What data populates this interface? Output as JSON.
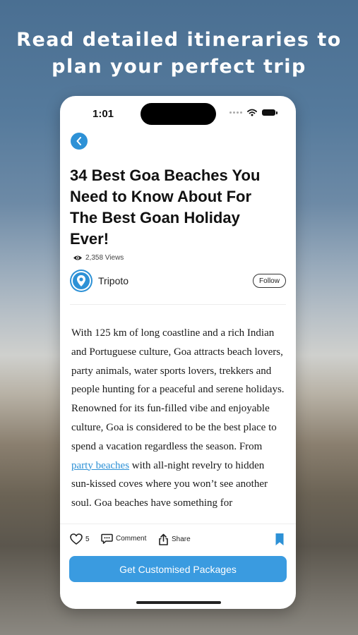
{
  "promo": {
    "line1": "Read detailed itineraries to",
    "line2": "plan your perfect trip"
  },
  "status_bar": {
    "time": "1:01",
    "icons": [
      "signal-dots-icon",
      "wifi-icon",
      "battery-icon"
    ]
  },
  "article": {
    "back_icon": "chevron-left-icon",
    "title": "34 Best Goa Beaches You Need to Know About For The Best Goan Holiday Ever!",
    "views": "2,358 Views",
    "author": {
      "name": "Tripoto",
      "follow_label": "Follow"
    },
    "body": {
      "part1": "With 125 km of long coastline and a rich Indian and Portuguese culture, Goa attracts beach lovers, party animals, water sports lovers, trekkers and people hunting for a peaceful and serene holidays. Renowned for its fun-filled vibe and enjoyable culture, Goa is considered to be the best place to spend a vacation regardless the season. From ",
      "link": "party beaches",
      "part2": " with all-night revelry to hidden sun-kissed coves where you won’t see another soul. Goa beaches have something for"
    }
  },
  "actions": {
    "likes": "5",
    "comment_label": "Comment",
    "share_label": "Share"
  },
  "cta": {
    "label": "Get Customised Packages"
  },
  "colors": {
    "accent": "#2d91d6",
    "cta": "#3a9be0"
  }
}
